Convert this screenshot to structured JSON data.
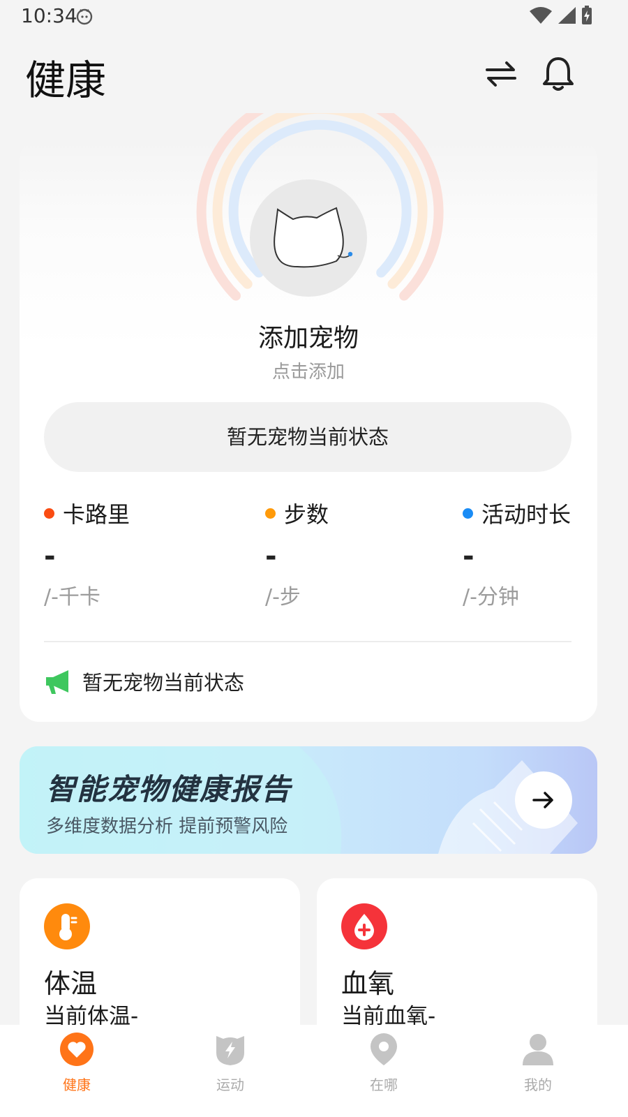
{
  "status_bar": {
    "time": "10:34"
  },
  "header": {
    "title": "健康"
  },
  "pet": {
    "add_title": "添加宠物",
    "add_subtitle": "点击添加",
    "status_text": "暂无宠物当前状态"
  },
  "metrics": [
    {
      "label": "卡路里",
      "value": "-",
      "unit": "/-千卡",
      "color": "#fa4c12"
    },
    {
      "label": "步数",
      "value": "-",
      "unit": "/-步",
      "color": "#ff9a0a"
    },
    {
      "label": "活动时长",
      "value": "-",
      "unit": "/-分钟",
      "color": "#1a8cf5"
    }
  ],
  "notice": {
    "text": "暂无宠物当前状态",
    "icon": "megaphone-icon",
    "color": "#3ec75e"
  },
  "report": {
    "title": "智能宠物健康报告",
    "subtitle": "多维度数据分析 提前预警风险"
  },
  "tiles": {
    "temperature": {
      "title": "体温",
      "value": "当前体温-",
      "icon": "thermometer-icon",
      "color": "#ff8a0d"
    },
    "oxygen": {
      "title": "血氧",
      "value": "当前血氧-",
      "icon": "blood-drop-icon",
      "color": "#f5333a"
    }
  },
  "nav": [
    {
      "label": "健康",
      "icon": "heart-icon",
      "active": true
    },
    {
      "label": "运动",
      "icon": "lightning-icon",
      "active": false
    },
    {
      "label": "在哪",
      "icon": "location-pin-icon",
      "active": false
    },
    {
      "label": "我的",
      "icon": "person-icon",
      "active": false
    }
  ],
  "colors": {
    "accent": "#ff7418",
    "inactive": "#c4c4c4"
  }
}
